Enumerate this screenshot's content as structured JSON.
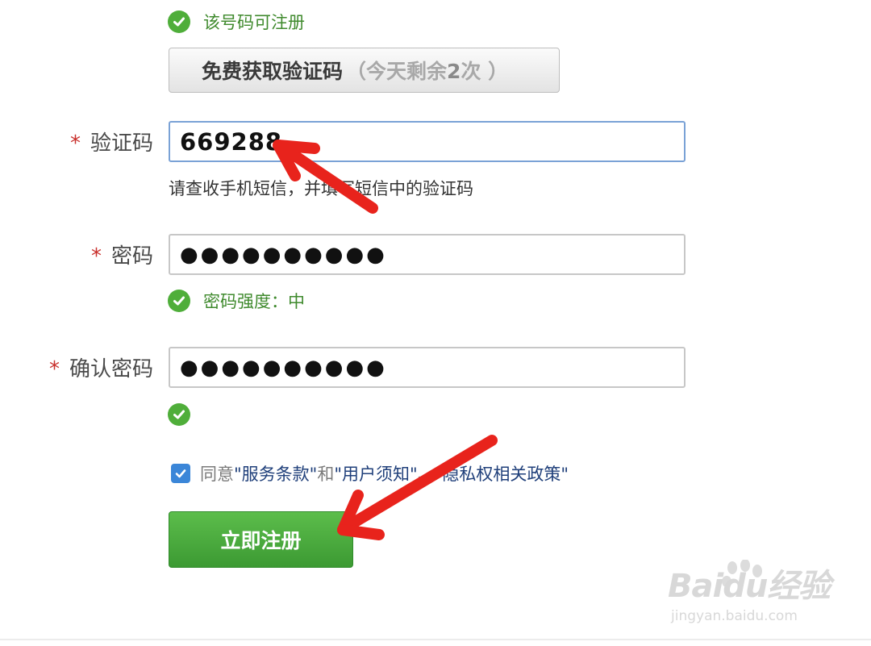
{
  "phone_status": "该号码可注册",
  "sms_button": {
    "label": "免费获取验证码",
    "remaining_prefix": "（今天剩余",
    "remaining_count": "2",
    "remaining_suffix": "次 ）"
  },
  "code_field": {
    "label": "验证码",
    "value": "669288",
    "hint": "请查收手机短信，并填写短信中的验证码"
  },
  "password_field": {
    "label": "密码",
    "masked": "●●●●●●●●●●",
    "strength": "密码强度：中"
  },
  "confirm_field": {
    "label": "确认密码",
    "masked": "●●●●●●●●●●"
  },
  "required_mark": "*",
  "agreement": {
    "checked": true,
    "prefix": "同意",
    "terms": "\"服务条款\"",
    "and": "和",
    "notice": "\"用户须知\"",
    "sep": "、",
    "privacy": "\"隐私权相关政策\""
  },
  "register_button": "立即注册",
  "watermark": {
    "brand": "Baidu经验",
    "url": "jingyan.baidu.com"
  },
  "colors": {
    "success_green": "#4fae3a",
    "button_green": "#46a83a",
    "required_red": "#c9302c",
    "arrow_red": "#e8231c",
    "checkbox_blue": "#3b86d8"
  }
}
